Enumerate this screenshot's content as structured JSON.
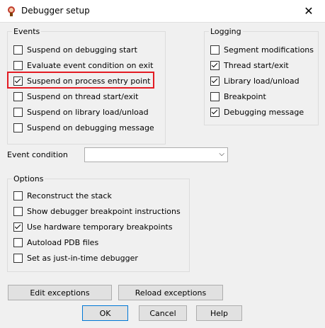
{
  "window": {
    "title": "Debugger setup",
    "close_glyph": "✕",
    "icon": "app-icon"
  },
  "events": {
    "legend": "Events",
    "items": [
      {
        "label": "Suspend on debugging start",
        "checked": false
      },
      {
        "label": "Evaluate event condition on exit",
        "checked": false
      },
      {
        "label": "Suspend on process entry point",
        "checked": true
      },
      {
        "label": "Suspend on thread start/exit",
        "checked": false
      },
      {
        "label": "Suspend on library load/unload",
        "checked": false
      },
      {
        "label": "Suspend on debugging message",
        "checked": false
      }
    ]
  },
  "logging": {
    "legend": "Logging",
    "items": [
      {
        "label": "Segment modifications",
        "checked": false
      },
      {
        "label": "Thread start/exit",
        "checked": true
      },
      {
        "label": "Library load/unload",
        "checked": true
      },
      {
        "label": "Breakpoint",
        "checked": false
      },
      {
        "label": "Debugging message",
        "checked": true
      }
    ]
  },
  "event_condition": {
    "label": "Event condition",
    "value": "",
    "chevron": "⌵"
  },
  "options": {
    "legend": "Options",
    "items": [
      {
        "label": "Reconstruct the stack",
        "checked": false
      },
      {
        "label": "Show debugger breakpoint instructions",
        "checked": false
      },
      {
        "label": "Use hardware temporary breakpoints",
        "checked": true
      },
      {
        "label": "Autoload PDB files",
        "checked": false
      },
      {
        "label": "Set as just-in-time debugger",
        "checked": false
      }
    ]
  },
  "buttons": {
    "edit_exceptions": "Edit exceptions",
    "reload_exceptions": "Reload exceptions",
    "ok": "OK",
    "cancel": "Cancel",
    "help": "Help"
  },
  "colors": {
    "highlight": "#e31b23",
    "default_button_border": "#0078d7"
  }
}
